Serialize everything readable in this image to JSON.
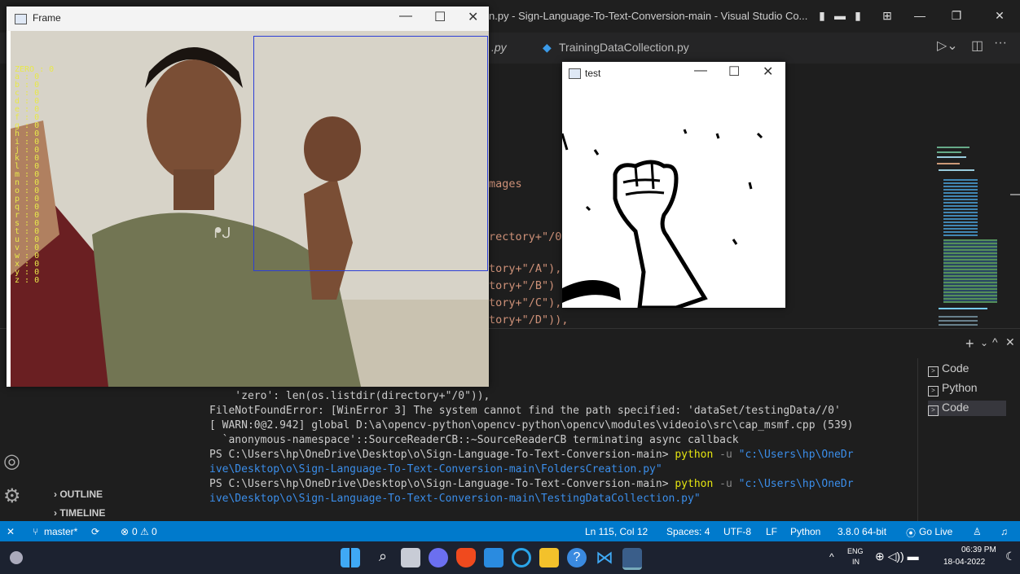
{
  "vscode": {
    "title": "n.py - Sign-Language-To-Text-Conversion-main - Visual Studio Co...",
    "tabs": [
      ".py",
      "TrainingDataCollection.py"
    ],
    "code_lines": [
      "mages",
      "rectory+\"/0",
      "tory+\"/A\"),",
      "tory+\"/B\")",
      "tory+\"/C\"),",
      "tory+\"/D\")),"
    ],
    "terminal": {
      "lines": [
        "    'zero': len(os.listdir(directory+\"/0\")),",
        "FileNotFoundError: [WinError 3] The system cannot find the path specified: 'dataSet/testingData//0'",
        "[ WARN:0@2.942] global D:\\a\\opencv-python\\opencv-python\\opencv\\modules\\videoio\\src\\cap_msmf.cpp (539)",
        "  `anonymous-namespace'::SourceReaderCB::~SourceReaderCB terminating async callback"
      ],
      "prompt": "PS C:\\Users\\hp\\OneDrive\\Desktop\\o\\Sign-Language-To-Text-Conversion-main>",
      "cmd": "python",
      "flag": "-u",
      "path1a": "\"c:\\Users\\hp\\OneDr",
      "path1b": "ive\\Desktop\\o\\Sign-Language-To-Text-Conversion-main\\FoldersCreation.py\"",
      "path2a": "\"c:\\Users\\hp\\OneDr",
      "path2b": "ive\\Desktop\\o\\Sign-Language-To-Text-Conversion-main\\TestingDataCollection.py\""
    },
    "terminal_list": [
      "Code",
      "Python",
      "Code"
    ],
    "sidebar": {
      "outline": "OUTLINE",
      "timeline": "TIMELINE"
    },
    "status": {
      "branch": "master*",
      "problems": "0",
      "warnings": "0",
      "position": "Ln 115, Col 12",
      "spaces": "Spaces: 4",
      "encoding": "UTF-8",
      "eol": "LF",
      "language": "Python",
      "interpreter": "3.8.0 64-bit",
      "golive": "Go Live"
    }
  },
  "frame_window": {
    "title": "Frame",
    "overlay_first": "ZERO : 0",
    "overlay_letters": [
      "a : 0",
      "b : 0",
      "c : 0",
      "d : 0",
      "e : 0",
      "f : 0",
      "g : 0",
      "h : 0",
      "i : 0",
      "j : 0",
      "k : 0",
      "l : 0",
      "m : 0",
      "n : 0",
      "o : 0",
      "p : 0",
      "q : 0",
      "r : 0",
      "s : 0",
      "t : 0",
      "u : 0",
      "v : 0",
      "w : 0",
      "x : 0",
      "y : 0",
      "z : 0"
    ]
  },
  "test_window": {
    "title": "test"
  },
  "taskbar": {
    "lang1": "ENG",
    "lang2": "IN",
    "time": "06:39 PM",
    "date": "18-04-2022"
  },
  "colors": {
    "statusbar": "#007acc",
    "taskbar": "#1c2230",
    "roi": "#2d3fd6",
    "overlay": "#e8e84a"
  }
}
